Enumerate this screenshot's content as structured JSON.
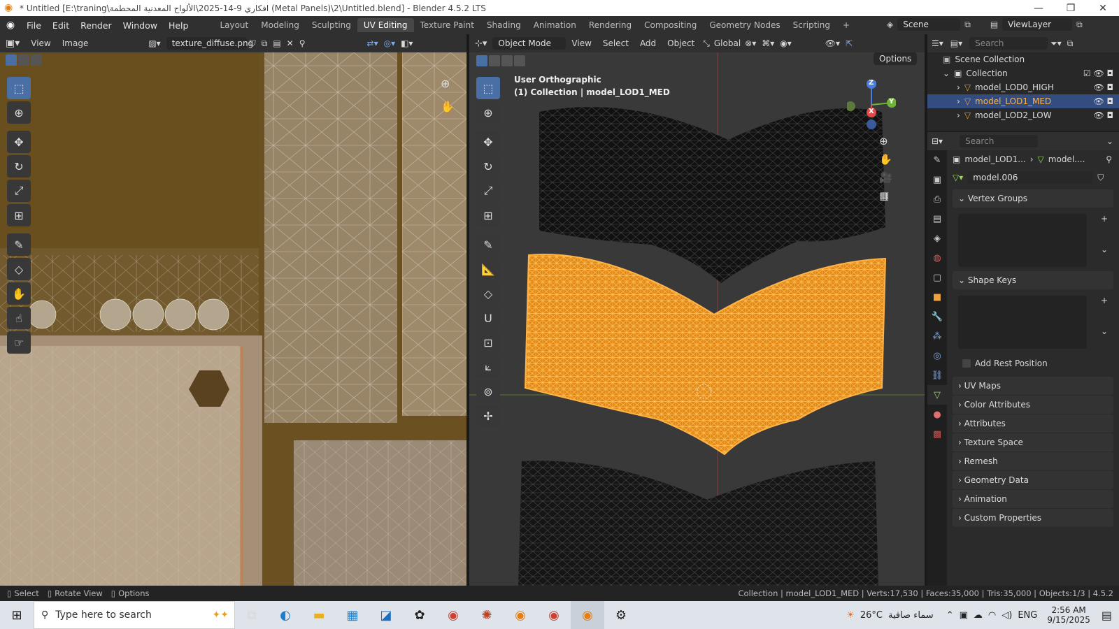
{
  "titlebar": {
    "title": "* Untitled [E:\\traning\\افكاري 9-14-2025\\الألواح المعدنية المحطمة (Metal Panels)\\2\\Untitled.blend] - Blender 4.5.2 LTS",
    "minimize": "—",
    "maximize": "❐",
    "close": "✕"
  },
  "topbar": {
    "menus": [
      "File",
      "Edit",
      "Render",
      "Window",
      "Help"
    ],
    "workspaces": [
      "Layout",
      "Modeling",
      "Sculpting",
      "UV Editing",
      "Texture Paint",
      "Shading",
      "Animation",
      "Rendering",
      "Compositing",
      "Geometry Nodes",
      "Scripting"
    ],
    "active_workspace": "UV Editing",
    "add_tab": "+",
    "scene": "Scene",
    "view_layer": "ViewLayer"
  },
  "uv_editor": {
    "view_menu": "View",
    "image_menu": "Image",
    "image_name": "texture_diffuse.png"
  },
  "viewport": {
    "mode": "Object Mode",
    "menus": [
      "View",
      "Select",
      "Add",
      "Object"
    ],
    "orientation": "Global",
    "options": "Options",
    "view_name": "User Orthographic",
    "collection_info": "(1) Collection | model_LOD1_MED",
    "gizmo": {
      "z": "Z",
      "y": "Y",
      "x": "X"
    }
  },
  "outliner": {
    "search_placeholder": "Search",
    "scene_collection": "Scene Collection",
    "collection": "Collection",
    "items": [
      {
        "name": "model_LOD0_HIGH",
        "selected": false
      },
      {
        "name": "model_LOD1_MED",
        "selected": true
      },
      {
        "name": "model_LOD2_LOW",
        "selected": false
      }
    ]
  },
  "properties": {
    "search_placeholder": "Search",
    "breadcrumb_object": "model_LOD1...",
    "breadcrumb_mesh": "model....",
    "mesh_name": "model.006",
    "panels_open": [
      "Vertex Groups",
      "Shape Keys"
    ],
    "add_rest_position": "Add Rest Position",
    "panels_closed": [
      "UV Maps",
      "Color Attributes",
      "Attributes",
      "Texture Space",
      "Remesh",
      "Geometry Data",
      "Animation",
      "Custom Properties"
    ]
  },
  "statusbar": {
    "select": "Select",
    "rotate_view": "Rotate View",
    "options": "Options",
    "stats": "Collection | model_LOD1_MED | Verts:17,530 | Faces:35,000 | Tris:35,000 | Objects:1/3 | 4.5.2"
  },
  "taskbar": {
    "search_placeholder": "Type here to search",
    "temperature": "26°C",
    "weather": "سماء صافية",
    "language": "ENG",
    "time": "2:56 AM",
    "date": "9/15/2025"
  },
  "colors": {
    "accent_blue": "#4a6fa5",
    "selected_orange": "#f0a23a",
    "selection_row": "#334d80"
  }
}
